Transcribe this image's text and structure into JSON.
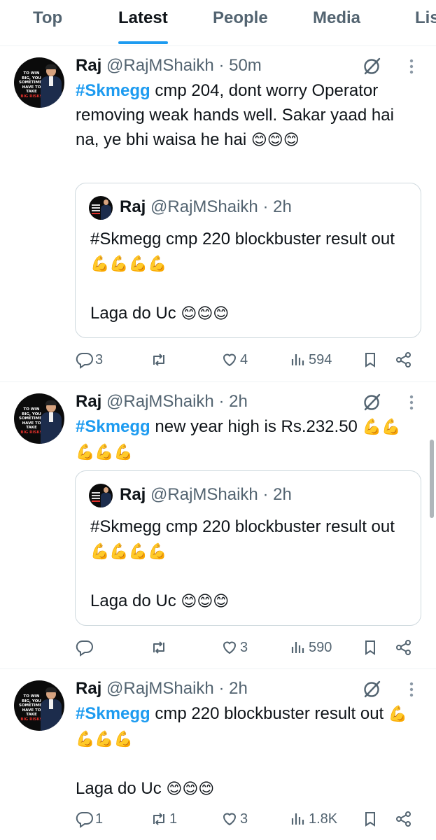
{
  "tabs": [
    {
      "label": "Top",
      "active": false
    },
    {
      "label": "Latest",
      "active": true
    },
    {
      "label": "People",
      "active": false
    },
    {
      "label": "Media",
      "active": false
    },
    {
      "label": "Lis",
      "active": false
    }
  ],
  "avatar_text": {
    "l1": "TO WIN",
    "l2": "BIG, YOU",
    "l3": "SOMETIMES",
    "l4": "HAVE TO",
    "l5": "TAKE",
    "l6": "BIG RISKS"
  },
  "tweets": [
    {
      "name": "Raj",
      "handle": "@RajMShaikh",
      "time": "· 50m",
      "tag": "#Skmegg",
      "text": " cmp 204, dont worry Operator removing weak hands well. Sakar yaad hai na, ye bhi waisa he hai ",
      "emoji": "😊😊😊",
      "quote": {
        "name": "Raj",
        "handle": "@RajMShaikh",
        "time": "· 2h",
        "line1": "#Skmegg cmp 220 blockbuster result out ",
        "emoji1": "💪💪💪💪",
        "line2": "Laga do Uc ",
        "emoji2": "😊😊😊"
      },
      "replies": "3",
      "reposts": "",
      "likes": "4",
      "views": "594"
    },
    {
      "name": "Raj",
      "handle": "@RajMShaikh",
      "time": "· 2h",
      "tag": "#Skmegg",
      "text": " new year high is Rs.232.50 ",
      "emoji": "💪💪💪💪💪",
      "quote": {
        "name": "Raj",
        "handle": "@RajMShaikh",
        "time": "· 2h",
        "line1": "#Skmegg cmp 220 blockbuster result out ",
        "emoji1": "💪💪💪💪",
        "line2": "Laga do Uc ",
        "emoji2": "😊😊😊"
      },
      "replies": "",
      "reposts": "",
      "likes": "3",
      "views": "590"
    },
    {
      "name": "Raj",
      "handle": "@RajMShaikh",
      "time": "· 2h",
      "tag": "#Skmegg",
      "text": " cmp 220 blockbuster result out ",
      "emoji": "💪💪💪💪",
      "line2": "Laga do Uc ",
      "emoji2": "😊😊😊",
      "replies": "1",
      "reposts": "1",
      "likes": "3",
      "views": "1.8K"
    }
  ],
  "colors": {
    "accent": "#1d9bf0",
    "text": "#0f1419",
    "secondary": "#536471",
    "border": "#cfd9de"
  },
  "icons": [
    "grok-icon",
    "more-icon",
    "reply-icon",
    "repost-icon",
    "like-icon",
    "views-icon",
    "bookmark-icon",
    "share-icon"
  ]
}
